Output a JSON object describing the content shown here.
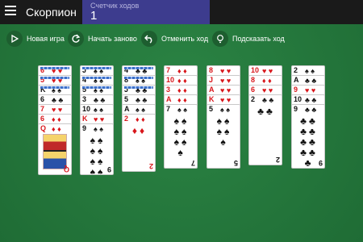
{
  "header": {
    "title": "Скорпион",
    "counter_label": "Счетчик ходов",
    "counter_value": "1"
  },
  "toolbar": {
    "new_game": "Новая игра",
    "restart": "Начать заново",
    "undo": "Отменить ход",
    "hint": "Подсказать ход"
  },
  "colors": {
    "felt": "#22763b",
    "topbar": "#1a1a1a",
    "counter_bg": "#3d3c8e",
    "red_suit": "#d8161b"
  },
  "columns": [
    {
      "cards": [
        {
          "rank": "6",
          "suit": "♥",
          "color": "red",
          "face": "down"
        },
        {
          "rank": "5",
          "suit": "♥",
          "color": "red",
          "face": "down"
        },
        {
          "rank": "K",
          "suit": "♠",
          "color": "black",
          "face": "down"
        },
        {
          "rank": "6",
          "suit": "♣",
          "color": "black",
          "face": "up"
        },
        {
          "rank": "7",
          "suit": "♥",
          "color": "red",
          "face": "up"
        },
        {
          "rank": "6",
          "suit": "♦",
          "color": "red",
          "face": "up"
        },
        {
          "rank": "Q",
          "suit": "♦",
          "color": "red",
          "face": "up"
        }
      ]
    },
    {
      "cards": [
        {
          "rank": "J",
          "suit": "♠",
          "color": "black",
          "face": "down"
        },
        {
          "rank": "4",
          "suit": "♠",
          "color": "black",
          "face": "down"
        },
        {
          "rank": "5",
          "suit": "♠",
          "color": "black",
          "face": "down"
        },
        {
          "rank": "3",
          "suit": "♣",
          "color": "black",
          "face": "up"
        },
        {
          "rank": "10",
          "suit": "♠",
          "color": "black",
          "face": "up"
        },
        {
          "rank": "K",
          "suit": "♥",
          "color": "red",
          "face": "up"
        },
        {
          "rank": "9",
          "suit": "♠",
          "color": "black",
          "face": "up"
        }
      ]
    },
    {
      "cards": [
        {
          "rank": "4",
          "suit": "♣",
          "color": "black",
          "face": "down"
        },
        {
          "rank": "8",
          "suit": "♠",
          "color": "black",
          "face": "down"
        },
        {
          "rank": "J",
          "suit": "♣",
          "color": "black",
          "face": "down"
        },
        {
          "rank": "5",
          "suit": "♣",
          "color": "black",
          "face": "up"
        },
        {
          "rank": "A",
          "suit": "♠",
          "color": "black",
          "face": "up"
        },
        {
          "rank": "2",
          "suit": "♦",
          "color": "red",
          "face": "up"
        }
      ]
    },
    {
      "cards": [
        {
          "rank": "7",
          "suit": "♦",
          "color": "red",
          "face": "up"
        },
        {
          "rank": "10",
          "suit": "♦",
          "color": "red",
          "face": "up"
        },
        {
          "rank": "3",
          "suit": "♦",
          "color": "red",
          "face": "up"
        },
        {
          "rank": "A",
          "suit": "♦",
          "color": "red",
          "face": "up"
        },
        {
          "rank": "7",
          "suit": "♠",
          "color": "black",
          "face": "up"
        }
      ]
    },
    {
      "cards": [
        {
          "rank": "8",
          "suit": "♥",
          "color": "red",
          "face": "up"
        },
        {
          "rank": "J",
          "suit": "♥",
          "color": "red",
          "face": "up"
        },
        {
          "rank": "A",
          "suit": "♥",
          "color": "red",
          "face": "up"
        },
        {
          "rank": "K",
          "suit": "♥",
          "color": "red",
          "face": "up"
        },
        {
          "rank": "5",
          "suit": "♠",
          "color": "black",
          "face": "up"
        }
      ]
    },
    {
      "cards": [
        {
          "rank": "10",
          "suit": "♥",
          "color": "red",
          "face": "up"
        },
        {
          "rank": "8",
          "suit": "♦",
          "color": "red",
          "face": "up"
        },
        {
          "rank": "6",
          "suit": "♥",
          "color": "red",
          "face": "up"
        },
        {
          "rank": "2",
          "suit": "♣",
          "color": "black",
          "face": "up"
        }
      ]
    },
    {
      "cards": [
        {
          "rank": "2",
          "suit": "♠",
          "color": "black",
          "face": "up"
        },
        {
          "rank": "A",
          "suit": "♣",
          "color": "black",
          "face": "up"
        },
        {
          "rank": "9",
          "suit": "♥",
          "color": "red",
          "face": "up"
        },
        {
          "rank": "10",
          "suit": "♣",
          "color": "black",
          "face": "up"
        },
        {
          "rank": "9",
          "suit": "♣",
          "color": "black",
          "face": "up"
        }
      ]
    }
  ]
}
